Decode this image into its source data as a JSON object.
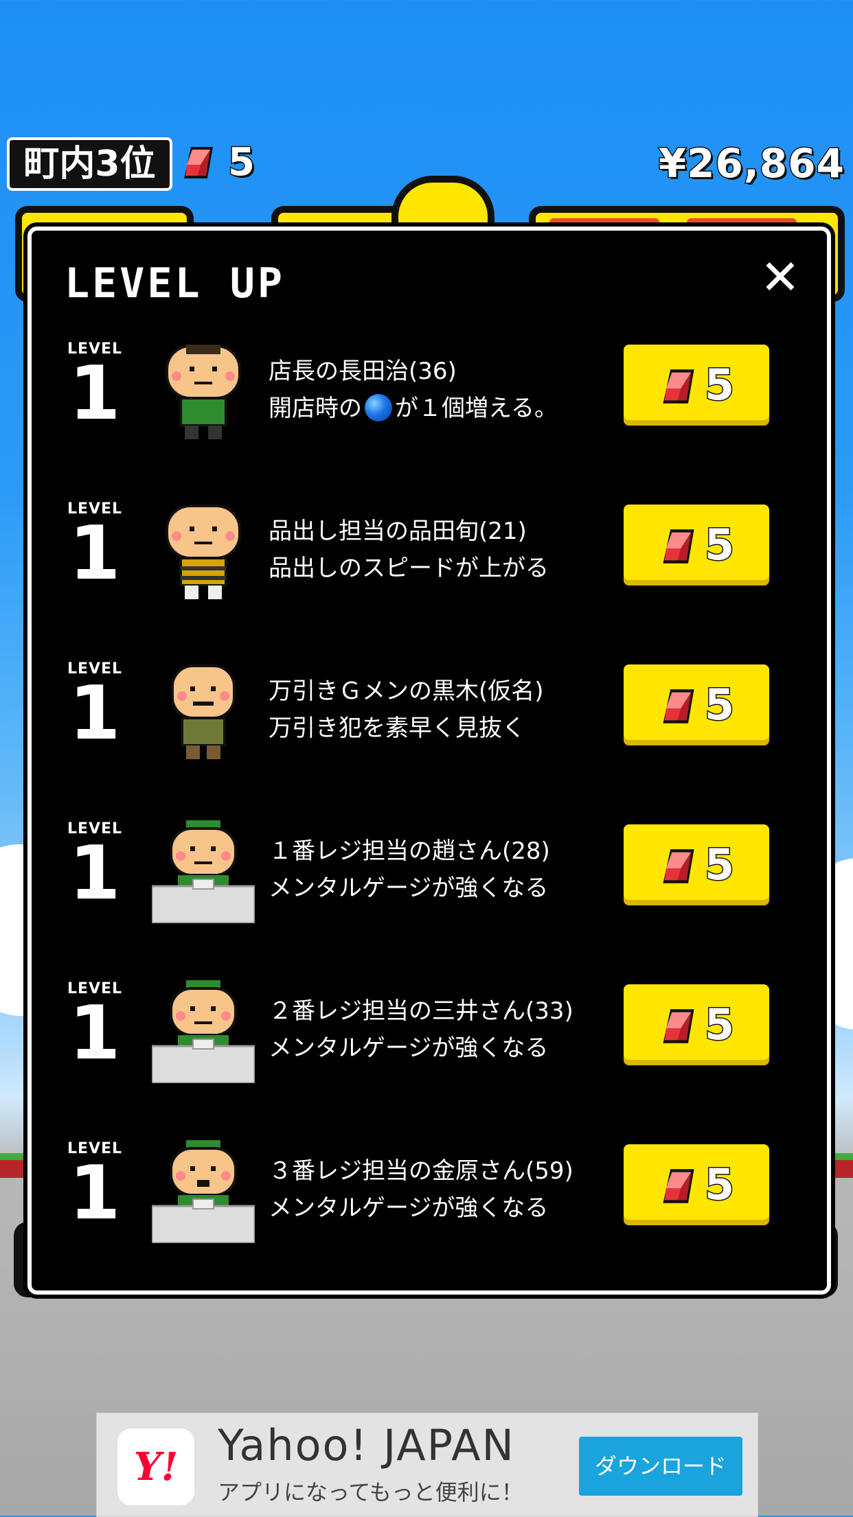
{
  "hud": {
    "rank": "町内3位",
    "gem_count": "5",
    "money": "¥26,864"
  },
  "modal": {
    "title": "LEVEL UP",
    "close": "✕",
    "level_label": "LEVEL",
    "rows": [
      {
        "level": "1",
        "line1": "店長の長田治(36)",
        "line2_pre": "開店時の",
        "line2_post": "が１個増える。",
        "cost": "5",
        "portrait": "manager"
      },
      {
        "level": "1",
        "line1": "品出し担当の品田旬(21)",
        "line2": "品出しのスピードが上がる",
        "cost": "5",
        "portrait": "stocker"
      },
      {
        "level": "1",
        "line1": "万引きＧメンの黒木(仮名)",
        "line2": "万引き犯を素早く見抜く",
        "cost": "5",
        "portrait": "guard"
      },
      {
        "level": "1",
        "line1": "１番レジ担当の趙さん(28)",
        "line2": "メンタルゲージが強くなる",
        "cost": "5",
        "portrait": "cashier"
      },
      {
        "level": "1",
        "line1": "２番レジ担当の三井さん(33)",
        "line2": "メンタルゲージが強くなる",
        "cost": "5",
        "portrait": "cashier"
      },
      {
        "level": "1",
        "line1": "３番レジ担当の金原さん(59)",
        "line2": "メンタルゲージが強くなる",
        "cost": "5",
        "portrait": "cashier-old"
      }
    ]
  },
  "ad": {
    "logo": "Y!",
    "title": "Yahoo! JAPAN",
    "subtitle": "アプリになってもっと便利に！",
    "button": "ダウンロード"
  },
  "colors": {
    "button_yellow": "#ffe600",
    "gem_red": "#e8323a",
    "ad_button": "#1aa3dc"
  }
}
